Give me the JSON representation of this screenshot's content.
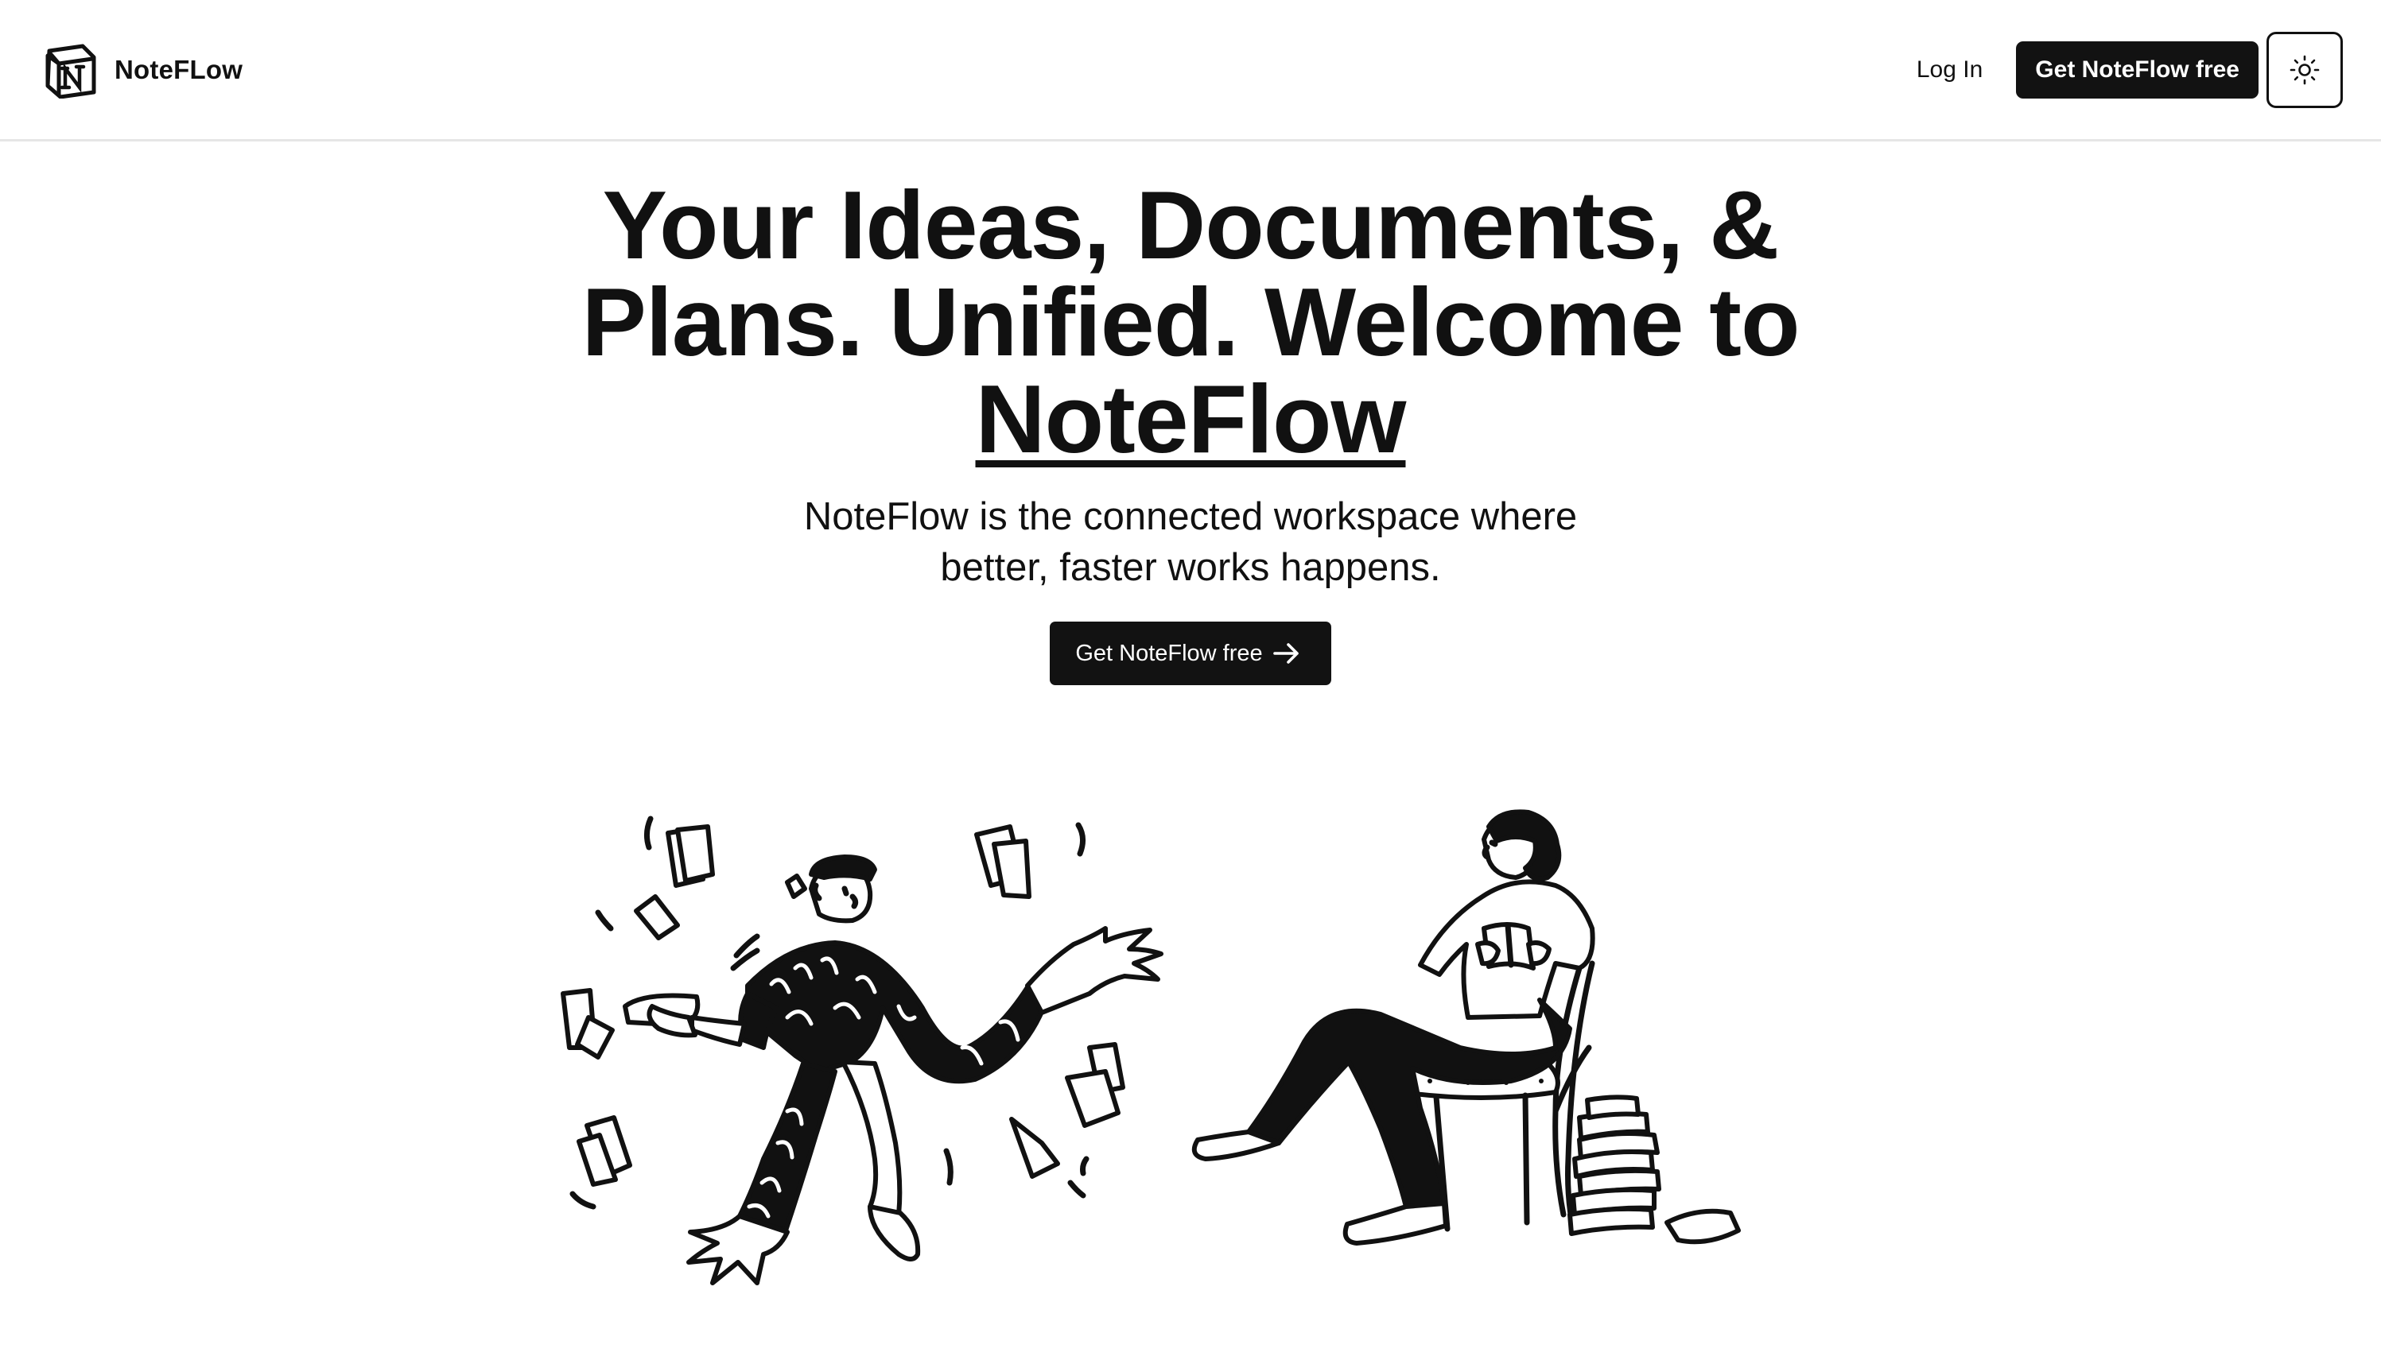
{
  "brand": {
    "name": "NoteFLow",
    "logo_icon": "notion-n-logo-icon"
  },
  "nav": {
    "login_label": "Log In",
    "cta_label": "Get NoteFlow free",
    "theme_toggle_icon": "sun-icon"
  },
  "hero": {
    "headline_part1": "Your Ideas, Documents, & Plans. Unified. Welcome to ",
    "headline_brand": "NoteFlow",
    "subtitle": "NoteFlow is the connected workspace where better, faster works happens.",
    "cta_label": "Get NoteFlow free",
    "cta_icon": "arrow-right-icon"
  },
  "illustrations": {
    "left": "juggling-papers-illustration",
    "right": "reading-person-illustration"
  },
  "colors": {
    "text": "#111111",
    "button_bg": "#121212",
    "button_text": "#ffffff",
    "divider": "#e6e6e6"
  }
}
